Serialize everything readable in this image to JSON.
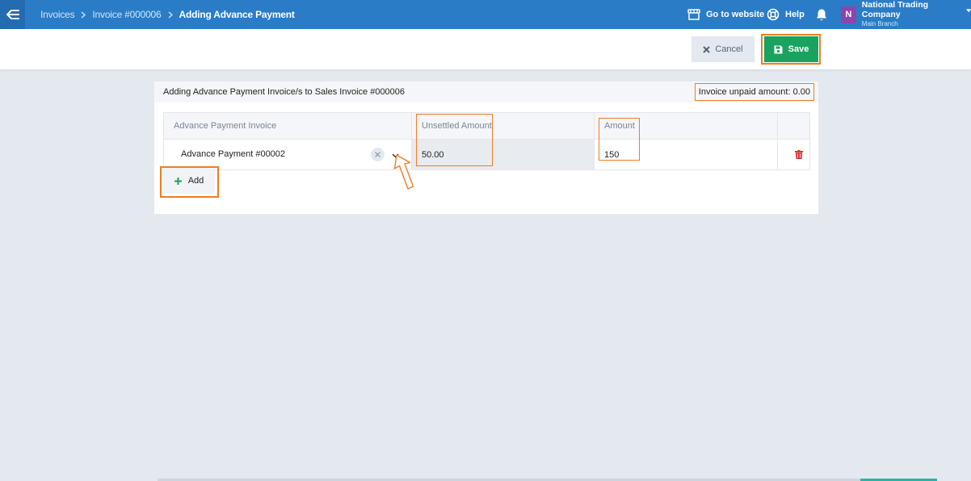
{
  "breadcrumb": [
    "Invoices",
    "Invoice #000006",
    "Adding Advance Payment"
  ],
  "header": {
    "go_to_website": "Go to website",
    "help": "Help",
    "avatar_letter": "N",
    "company_name": "National Trading Company",
    "branch": "Main Branch"
  },
  "toolbar": {
    "cancel_label": "Cancel",
    "save_label": "Save"
  },
  "panel": {
    "title": "Adding Advance Payment Invoice/s to Sales Invoice #000006",
    "unpaid_amount": "Invoice unpaid amount: 0.00"
  },
  "table": {
    "headers": [
      "Advance Payment Invoice",
      "Unsettled Amount",
      "Amount"
    ],
    "rows": [
      {
        "invoice": "Advance Payment #00002",
        "unsettled": "50.00",
        "amount": "150"
      }
    ]
  },
  "add_label": "Add",
  "colors": {
    "topbar": "#2a7cc7",
    "save": "#1aa35e",
    "highlight": "#f07d22",
    "delete": "#e02424",
    "avatar": "#8e44ad"
  }
}
